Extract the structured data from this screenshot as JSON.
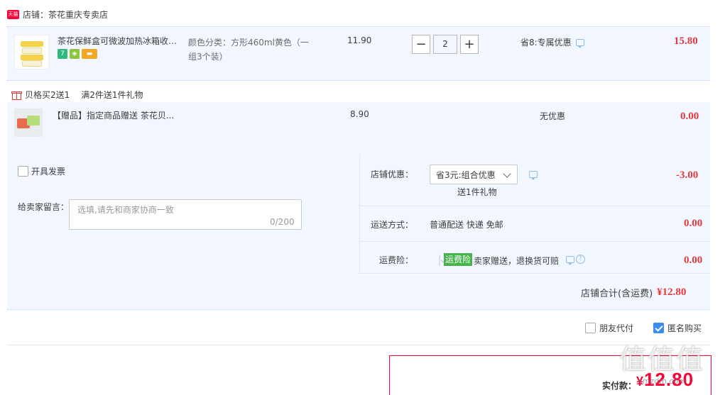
{
  "shop": {
    "prefix": "店铺：",
    "name": "茶花重庆专卖店",
    "badge": "天猫"
  },
  "item1": {
    "title": "茶花保鲜盒可微波加热冰箱收纳盒",
    "sku": "颜色分类：方形460ml黄色（一组3个装）",
    "unit_price": "11.90",
    "quantity": "2",
    "promo": "省8:专属优惠",
    "subtotal": "15.80",
    "service_icons": [
      "7-day-return-icon",
      "shield-icon",
      "card-icon"
    ]
  },
  "gift_section": {
    "header": "贝格买2送1",
    "rule": "满2件送1件礼物",
    "item": {
      "title": "【赠品】指定商品赠送 茶花贝...",
      "unit_price": "8.90",
      "promo": "无优惠",
      "subtotal": "0.00"
    }
  },
  "order": {
    "invoice_label": "开具发票",
    "message_label": "给卖家留言：",
    "message_placeholder": "选填,请先和商家协商一致",
    "message_count": "0/200",
    "shop_discount_label": "店铺优惠：",
    "shop_discount_selected": "省3元:组合优惠",
    "shop_discount_note": "送1件礼物",
    "shop_discount_value": "-3.00",
    "shipping_label": "运送方式：",
    "shipping_value": "普通配送 快递 免邮",
    "shipping_price": "0.00",
    "insurance_label": "运费险：",
    "insurance_tag": "运费险",
    "insurance_text": "卖家赠送，退换货可赔",
    "insurance_price": "0.00",
    "shop_total_label": "店铺合计(含运费)",
    "shop_total_value": "¥12.80"
  },
  "options": {
    "friend_pay": "朋友代付",
    "anonymous": "匿名购买"
  },
  "payment": {
    "label": "实付款：",
    "currency": "¥",
    "amount": "12.80"
  },
  "watermark": {
    "text": "值值值",
    "url": "smzdm.com"
  },
  "colors": {
    "price_red": "#e4393c",
    "accent_red": "#ff0036",
    "row_bg": "#f2f7ff",
    "insurance_green": "#44b549",
    "check_blue": "#3b8cf0"
  }
}
